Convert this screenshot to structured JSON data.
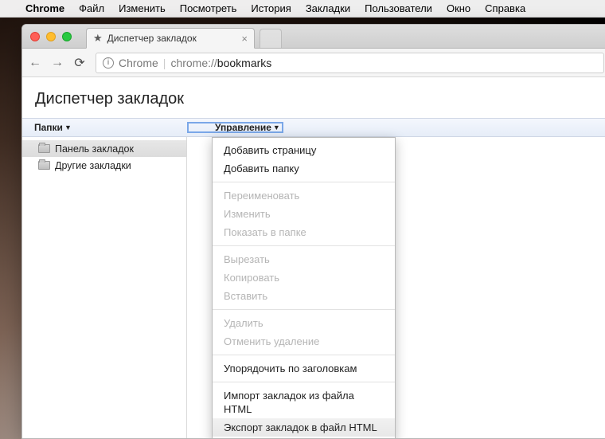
{
  "menubar": {
    "app": "Chrome",
    "items": [
      "Файл",
      "Изменить",
      "Посмотреть",
      "История",
      "Закладки",
      "Пользователи",
      "Окно",
      "Справка"
    ]
  },
  "tab": {
    "title": "Диспетчер закладок"
  },
  "omnibox": {
    "site_label": "Chrome",
    "url_prefix": "chrome://",
    "url_path": "bookmarks"
  },
  "page": {
    "title": "Диспетчер закладок"
  },
  "subheader": {
    "folders": "Папки",
    "manage": "Управление"
  },
  "sidebar": {
    "items": [
      {
        "label": "Панель закладок",
        "selected": true
      },
      {
        "label": "Другие закладки",
        "selected": false
      }
    ]
  },
  "menu": {
    "add_page": "Добавить страницу",
    "add_folder": "Добавить папку",
    "rename": "Переименовать",
    "edit": "Изменить",
    "show_in_folder": "Показать в папке",
    "cut": "Вырезать",
    "copy": "Копировать",
    "paste": "Вставить",
    "delete": "Удалить",
    "undo_delete": "Отменить удаление",
    "sort": "Упорядочить по заголовкам",
    "import": "Импорт закладок из файла HTML",
    "export": "Экспорт закладок в файл HTML"
  }
}
